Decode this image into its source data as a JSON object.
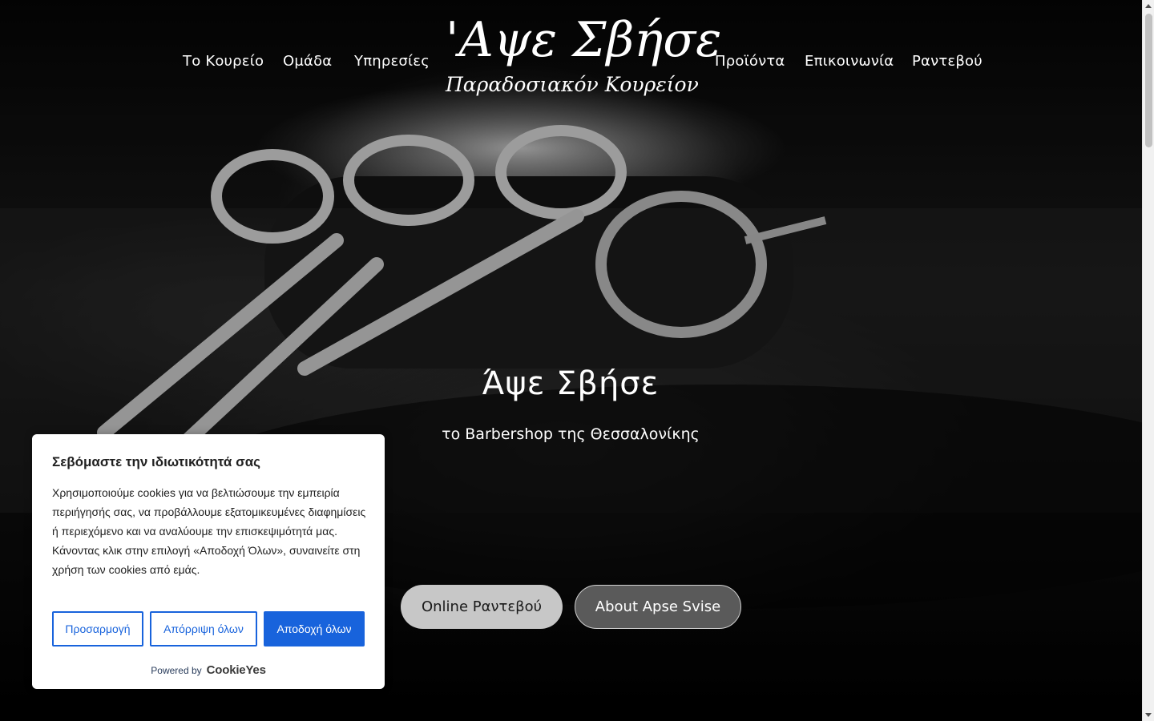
{
  "nav": {
    "left": [
      {
        "label": "Το Κουρείο"
      },
      {
        "label": "Ομάδα"
      },
      {
        "label": "Υπηρεσίες"
      }
    ],
    "right": [
      {
        "label": "Προϊόντα"
      },
      {
        "label": "Επικοινωνία"
      },
      {
        "label": "Ραντεβού"
      }
    ]
  },
  "logo": {
    "main": "'Αψε Σβήσε",
    "sub": "Παραδοσιακόν Κουρείον"
  },
  "hero": {
    "title": "Άψε Σβήσε",
    "subtitle": "το Barbershop της Θεσσαλονίκης",
    "primary_button": "Online Ραντεβού",
    "secondary_button": "About Apse Svise"
  },
  "cookie_banner": {
    "title": "Σεβόμαστε την ιδιωτικότητά σας",
    "text": "Χρησιμοποιούμε cookies για να βελτιώσουμε την εμπειρία περιήγησής σας, να προβάλλουμε εξατομικευμένες διαφημίσεις ή περιεχόμενο και να αναλύουμε την επισκεψιμότητά μας. Κάνοντας κλικ στην επιλογή «Αποδοχή Όλων», συναινείτε στη χρήση των cookies από εμάς.",
    "customize_label": "Προσαρμογή",
    "reject_label": "Απόρριψη όλων",
    "accept_label": "Αποδοχή όλων",
    "powered_by": "Powered by",
    "brand": "CookieYes"
  },
  "colors": {
    "accent_blue": "#1863dc",
    "primary_button_bg": "#c7c7c7",
    "secondary_button_bg": "#5a5a5a"
  }
}
